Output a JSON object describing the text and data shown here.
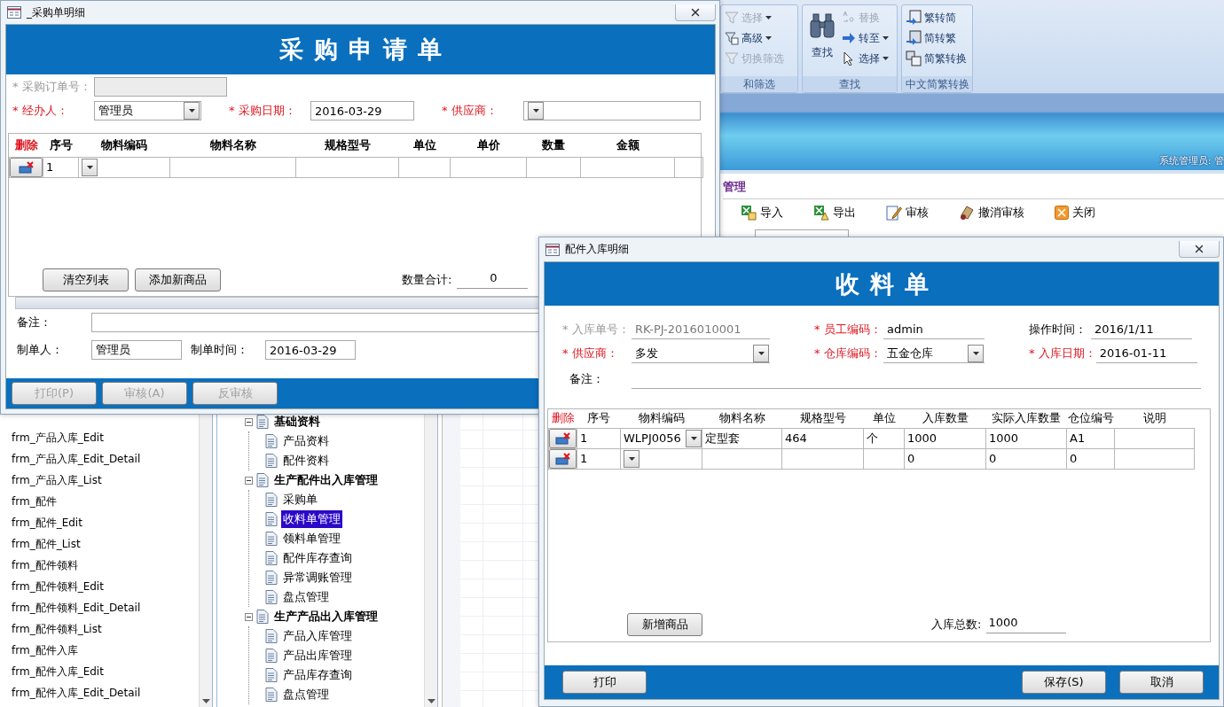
{
  "app": {
    "ribbon": {
      "groups": [
        {
          "label": "和筛选",
          "items": [
            {
              "label": "选择",
              "disabled": true,
              "dropdown": true
            },
            {
              "label": "高级",
              "disabled": false,
              "dropdown": true
            },
            {
              "label": "切换筛选",
              "disabled": true,
              "dropdown": false
            }
          ]
        },
        {
          "label": "查找",
          "large": "查找",
          "items": [
            {
              "label": "替换",
              "disabled": true,
              "dropdown": false
            },
            {
              "label": "转至",
              "disabled": false,
              "dropdown": true
            },
            {
              "label": "选择",
              "disabled": false,
              "dropdown": true
            }
          ]
        },
        {
          "label": "中文简繁转换",
          "items": [
            {
              "label": "繁转简",
              "disabled": false,
              "dropdown": false
            },
            {
              "label": "简转繁",
              "disabled": false,
              "dropdown": false
            },
            {
              "label": "简繁转换",
              "disabled": false,
              "dropdown": false
            }
          ]
        }
      ]
    },
    "user_label": "系统管理员: 管",
    "page_title": "管理",
    "toolbar": [
      "导入",
      "导出",
      "审核",
      "撤消审核",
      "关闭"
    ],
    "object_list": [
      "frm_产品入库_Edit",
      "frm_产品入库_Edit_Detail",
      "frm_产品入库_List",
      "frm_配件",
      "frm_配件_Edit",
      "frm_配件_List",
      "frm_配件领料",
      "frm_配件领料_Edit",
      "frm_配件领料_Edit_Detail",
      "frm_配件领料_List",
      "frm_配件入库",
      "frm_配件入库_Edit",
      "frm_配件入库_Edit_Detail"
    ],
    "nav_tree": [
      {
        "label": "基础资料",
        "expanded": true,
        "selected": false,
        "children": [
          {
            "label": "产品资料",
            "selected": false
          },
          {
            "label": "配件资料",
            "selected": false
          }
        ]
      },
      {
        "label": "生产配件出入库管理",
        "expanded": true,
        "selected": false,
        "children": [
          {
            "label": "采购单",
            "selected": false
          },
          {
            "label": "收料单管理",
            "selected": true
          },
          {
            "label": "领料单管理",
            "selected": false
          },
          {
            "label": "配件库存查询",
            "selected": false
          },
          {
            "label": "异常调账管理",
            "selected": false
          },
          {
            "label": "盘点管理",
            "selected": false
          }
        ]
      },
      {
        "label": "生产产品出入库管理",
        "expanded": true,
        "selected": false,
        "children": [
          {
            "label": "产品入库管理",
            "selected": false
          },
          {
            "label": "产品出库管理",
            "selected": false
          },
          {
            "label": "产品库存查询",
            "selected": false
          },
          {
            "label": "盘点管理",
            "selected": false
          }
        ]
      }
    ]
  },
  "purchase_window": {
    "title": "_采购单明细",
    "heading": "采购申请单",
    "fields": [
      [
        {
          "label": "* 采购订单号：",
          "kind": "text",
          "required": false,
          "disabled": true
        }
      ],
      [
        {
          "label": "* 经办人：",
          "value": "管理员",
          "kind": "combo",
          "required": true,
          "disabled": false
        },
        {
          "label": "* 采购日期：",
          "value": "2016-03-29",
          "kind": "text",
          "required": true,
          "disabled": false
        },
        {
          "label": "* 供应商：",
          "kind": "combo",
          "required": true,
          "disabled": false
        }
      ]
    ],
    "grid": {
      "columns": [
        {
          "label": "删除",
          "kind": "delete"
        },
        {
          "label": "序号",
          "kind": "text"
        },
        {
          "label": "物料编码",
          "kind": "combo"
        },
        {
          "label": "物料名称",
          "kind": "text"
        },
        {
          "label": "规格型号",
          "kind": "text"
        },
        {
          "label": "单位",
          "kind": "text"
        },
        {
          "label": "单价",
          "kind": "text"
        },
        {
          "label": "数量",
          "kind": "text"
        },
        {
          "label": "金额",
          "kind": "text"
        }
      ],
      "rows": [
        {
          "cells": [
            null,
            "1",
            null,
            null,
            null,
            null,
            null,
            null,
            null
          ]
        }
      ]
    },
    "buttons": [
      "清空列表",
      "添加新商品"
    ],
    "total": {
      "label": "数量合计:",
      "value": "0"
    },
    "remark": {
      "label": "备注："
    },
    "maker": [
      {
        "label": "制单人：",
        "value": "管理员"
      },
      {
        "label": "制单时间：",
        "value": "2016-03-29"
      }
    ],
    "footer_buttons": [
      {
        "label": "打印(P)",
        "disabled": true
      },
      {
        "label": "审核(A)",
        "disabled": true
      },
      {
        "label": "反审核",
        "disabled": true
      }
    ]
  },
  "receipt_window": {
    "title": "配件入库明细",
    "heading": "收料单",
    "fields": [
      [
        {
          "label": "* 入库单号：",
          "value": "RK-PJ-2016010001",
          "kind": "text",
          "required": false,
          "disabled": true
        },
        {
          "label": "* 员工编码：",
          "value": "admin",
          "kind": "text",
          "required": true,
          "disabled": false
        },
        {
          "label": "操作时间：",
          "value": "2016/1/11",
          "kind": "text",
          "required": false,
          "disabled": false
        }
      ],
      [
        {
          "label": "* 供应商：",
          "value": "多发",
          "kind": "combo",
          "required": true,
          "disabled": false
        },
        {
          "label": "* 仓库编码：",
          "value": "五金仓库",
          "kind": "combo",
          "required": true,
          "disabled": false
        },
        {
          "label": "* 入库日期：",
          "value": "2016-01-11",
          "kind": "text",
          "required": true,
          "disabled": false
        }
      ]
    ],
    "remark": {
      "label": "备注："
    },
    "grid": {
      "columns": [
        {
          "label": "删除",
          "kind": "delete"
        },
        {
          "label": "序号",
          "kind": "text"
        },
        {
          "label": "物料编码",
          "kind": "combo"
        },
        {
          "label": "物料名称",
          "kind": "text"
        },
        {
          "label": "规格型号",
          "kind": "text"
        },
        {
          "label": "单位",
          "kind": "text"
        },
        {
          "label": "入库数量",
          "kind": "text"
        },
        {
          "label": "实际入库数量",
          "kind": "text"
        },
        {
          "label": "仓位编号",
          "kind": "text"
        },
        {
          "label": "说明",
          "kind": "text"
        }
      ],
      "rows": [
        {
          "cells": [
            null,
            "1",
            "WLPJ0056",
            "定型套",
            "464",
            "个",
            "1000",
            "1000",
            "A1",
            null
          ]
        },
        {
          "cells": [
            null,
            "1",
            null,
            null,
            null,
            null,
            "0",
            "0",
            "0",
            null
          ]
        }
      ]
    },
    "add_button": "新增商品",
    "total": {
      "label": "入库总数:",
      "value": "1000"
    },
    "footer_left": [
      "打印"
    ],
    "footer_right": [
      "保存(S)",
      "取消"
    ]
  }
}
